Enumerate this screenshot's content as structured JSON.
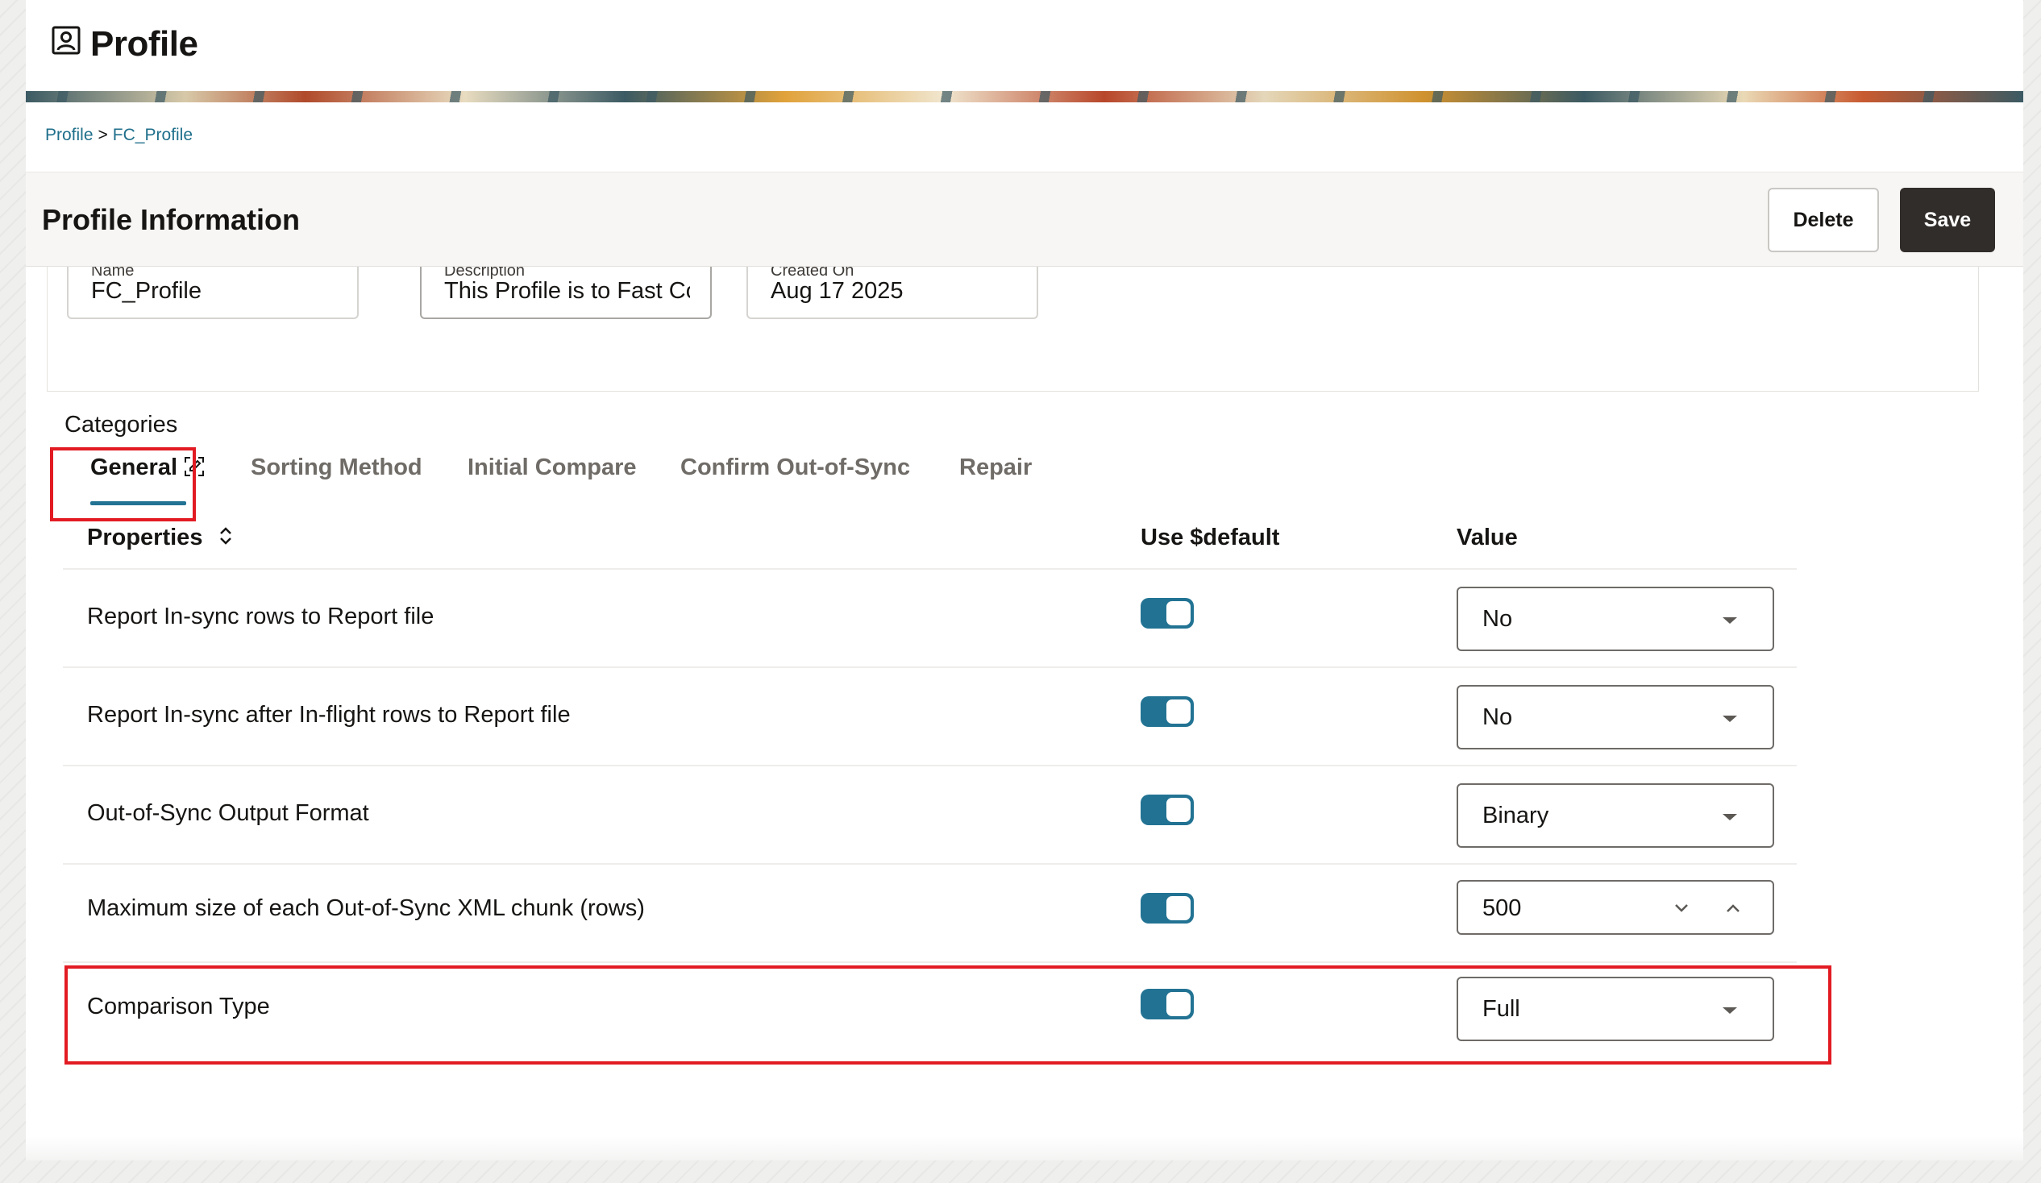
{
  "header": {
    "title": "Profile",
    "icon": "profile-icon"
  },
  "breadcrumb": {
    "root": "Profile",
    "separator": ">",
    "current": "FC_Profile"
  },
  "info": {
    "title": "Profile Information",
    "delete_label": "Delete",
    "save_label": "Save"
  },
  "fields": {
    "name": {
      "label": "Name",
      "value": "FC_Profile"
    },
    "description": {
      "label": "Description",
      "value": "This Profile is to Fast Compare"
    },
    "created_on": {
      "label": "Created On",
      "value": "Aug 17 2025"
    }
  },
  "categories": {
    "label": "Categories",
    "tabs": [
      {
        "label": "General",
        "active": true,
        "icon": "tab-edit-icon"
      },
      {
        "label": "Sorting Method"
      },
      {
        "label": "Initial Compare"
      },
      {
        "label": "Confirm Out-of-Sync"
      },
      {
        "label": "Repair"
      }
    ]
  },
  "table": {
    "headers": {
      "properties": "Properties",
      "use_default": "Use $default",
      "value": "Value"
    },
    "rows": [
      {
        "property": "Report In-sync rows to Report file",
        "use_default": true,
        "value": "No",
        "control": "select"
      },
      {
        "property": "Report In-sync after In-flight rows to Report file",
        "use_default": true,
        "value": "No",
        "control": "select"
      },
      {
        "property": "Out-of-Sync Output Format",
        "use_default": true,
        "value": "Binary",
        "control": "select"
      },
      {
        "property": "Maximum size of each Out-of-Sync XML chunk (rows)",
        "use_default": true,
        "value": "500",
        "control": "stepper"
      },
      {
        "property": "Comparison Type",
        "use_default": true,
        "value": "Full",
        "control": "select"
      }
    ]
  },
  "colors": {
    "accent": "#227393",
    "highlight": "#e21b23",
    "save_button": "#312d2a",
    "link": "#1f6f8b"
  }
}
